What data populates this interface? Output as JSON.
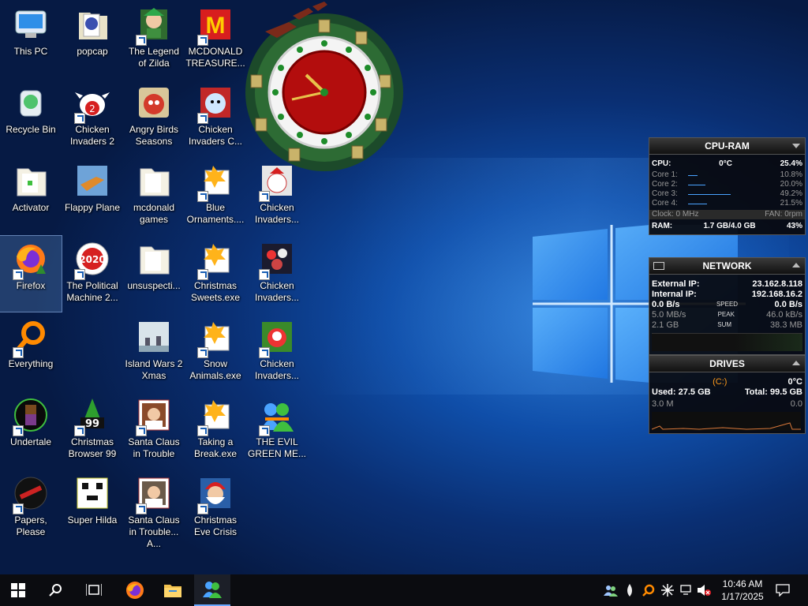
{
  "desktop": {
    "icons": [
      {
        "label": "This PC"
      },
      {
        "label": "popcap"
      },
      {
        "label": "The Legend of Zilda"
      },
      {
        "label": "MCDONALD TREASURE..."
      },
      {
        "label": "Recycle Bin"
      },
      {
        "label": "Chicken Invaders 2"
      },
      {
        "label": "Angry Birds Seasons"
      },
      {
        "label": "Chicken Invaders C..."
      },
      {
        "label": "Activator"
      },
      {
        "label": "Flappy Plane"
      },
      {
        "label": "mcdonald games"
      },
      {
        "label": "Blue Ornaments...."
      },
      {
        "label": "Chicken Invaders..."
      },
      {
        "label": "Firefox"
      },
      {
        "label": "The Political Machine 2..."
      },
      {
        "label": "unsuspecti..."
      },
      {
        "label": "Christmas Sweets.exe"
      },
      {
        "label": "Chicken Invaders..."
      },
      {
        "label": "Everything"
      },
      {
        "label": "Island Wars 2 Xmas"
      },
      {
        "label": "Snow Animals.exe"
      },
      {
        "label": "Chicken Invaders..."
      },
      {
        "label": "Undertale"
      },
      {
        "label": "Christmas Browser 99"
      },
      {
        "label": "Santa Claus in Trouble"
      },
      {
        "label": "Taking a Break.exe"
      },
      {
        "label": "THE EVIL GREEN ME..."
      },
      {
        "label": "Papers, Please"
      },
      {
        "label": "Super Hilda"
      },
      {
        "label": "Santa Claus in Trouble... A..."
      },
      {
        "label": "Christmas Eve Crisis"
      }
    ],
    "political_badge": "2020",
    "christmas_browser_badge": "99",
    "mcdonald_logo": "M"
  },
  "cpu_ram": {
    "title": "CPU-RAM",
    "cpu_label": "CPU:",
    "cpu_temp": "0°C",
    "cpu_value": "25.4%",
    "cores": [
      {
        "label": "Core 1:",
        "value": "10.8%",
        "level": 0.108
      },
      {
        "label": "Core 2:",
        "value": "20.0%",
        "level": 0.2
      },
      {
        "label": "Core 3:",
        "value": "49.2%",
        "level": 0.492
      },
      {
        "label": "Core 4:",
        "value": "21.5%",
        "level": 0.215
      }
    ],
    "clock": "Clock: 0 MHz",
    "fan": "FAN: 0rpm",
    "ram_label": "RAM:",
    "ram_value": "1.7 GB/4.0 GB",
    "ram_pct": "43%"
  },
  "network": {
    "title": "NETWORK",
    "external_ip_label": "External IP:",
    "external_ip": "23.162.8.118",
    "internal_ip_label": "Internal IP:",
    "internal_ip": "192.168.16.2",
    "speed_down": "0.0 B/s",
    "speed_label": "SPEED",
    "speed_up": "0.0 B/s",
    "peak_down": "5.0 MB/s",
    "peak_label": "PEAK",
    "peak_up": "46.0 kB/s",
    "sum_down": "2.1 GB",
    "sum_label": "SUM",
    "sum_up": "38.3 MB"
  },
  "drives": {
    "title": "DRIVES",
    "drive_letter": "(C:)",
    "temp": "0°C",
    "used": "Used: 27.5 GB",
    "total": "Total: 99.5 GB",
    "read": "3.0 M",
    "write": "0.0"
  },
  "taskbar": {
    "time": "10:46 AM",
    "date": "1/17/2025"
  },
  "colors": {
    "accent": "#1a5fb4",
    "gadget_bar": "#4aa3ff",
    "drive_letter": "#ff9a1a"
  }
}
